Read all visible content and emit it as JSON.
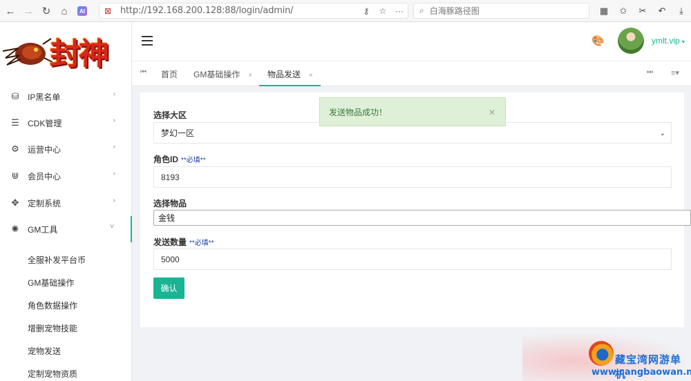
{
  "browser": {
    "url": "http://192.168.200.128:88/login/admin/",
    "search_text": "白海豚路径图",
    "ai_label": "AI"
  },
  "sidebar": {
    "logo_text": "封神",
    "menu": [
      {
        "label": "IP黑名单",
        "icon": "database-icon"
      },
      {
        "label": "CDK管理",
        "icon": "list-icon"
      },
      {
        "label": "运营中心",
        "icon": "gear-icon"
      },
      {
        "label": "会员中心",
        "icon": "magnet-icon"
      },
      {
        "label": "定制系统",
        "icon": "diamond-icon"
      },
      {
        "label": "GM工具",
        "icon": "bulb-icon"
      }
    ],
    "sub_menu": [
      "全服补发平台币",
      "GM基础操作",
      "角色数据操作",
      "增删宠物技能",
      "宠物发送",
      "定制宠物资质"
    ]
  },
  "header": {
    "username": "ymlt.vip"
  },
  "tabs": [
    {
      "label": "首页"
    },
    {
      "label": "GM基础操作"
    },
    {
      "label": "物品发送"
    }
  ],
  "form": {
    "region_label": "选择大区",
    "region_value": "梦幻一区",
    "role_label": "角色ID",
    "role_required": "**必填**",
    "role_value": "8193",
    "item_label": "选择物品",
    "item_value": "金钱",
    "count_label": "发送数量",
    "count_required": "**必填**",
    "count_value": "5000",
    "submit_label": "确认"
  },
  "toast": {
    "message": "发送物品成功！"
  },
  "watermark": {
    "title": "藏宝湾网游单机",
    "url": "www.cangbaowan.net"
  },
  "colors": {
    "accent": "#1ab394",
    "toast_bg": "#dff0d8",
    "toast_text": "#3c763d",
    "required_text": "#1a3ea8"
  }
}
